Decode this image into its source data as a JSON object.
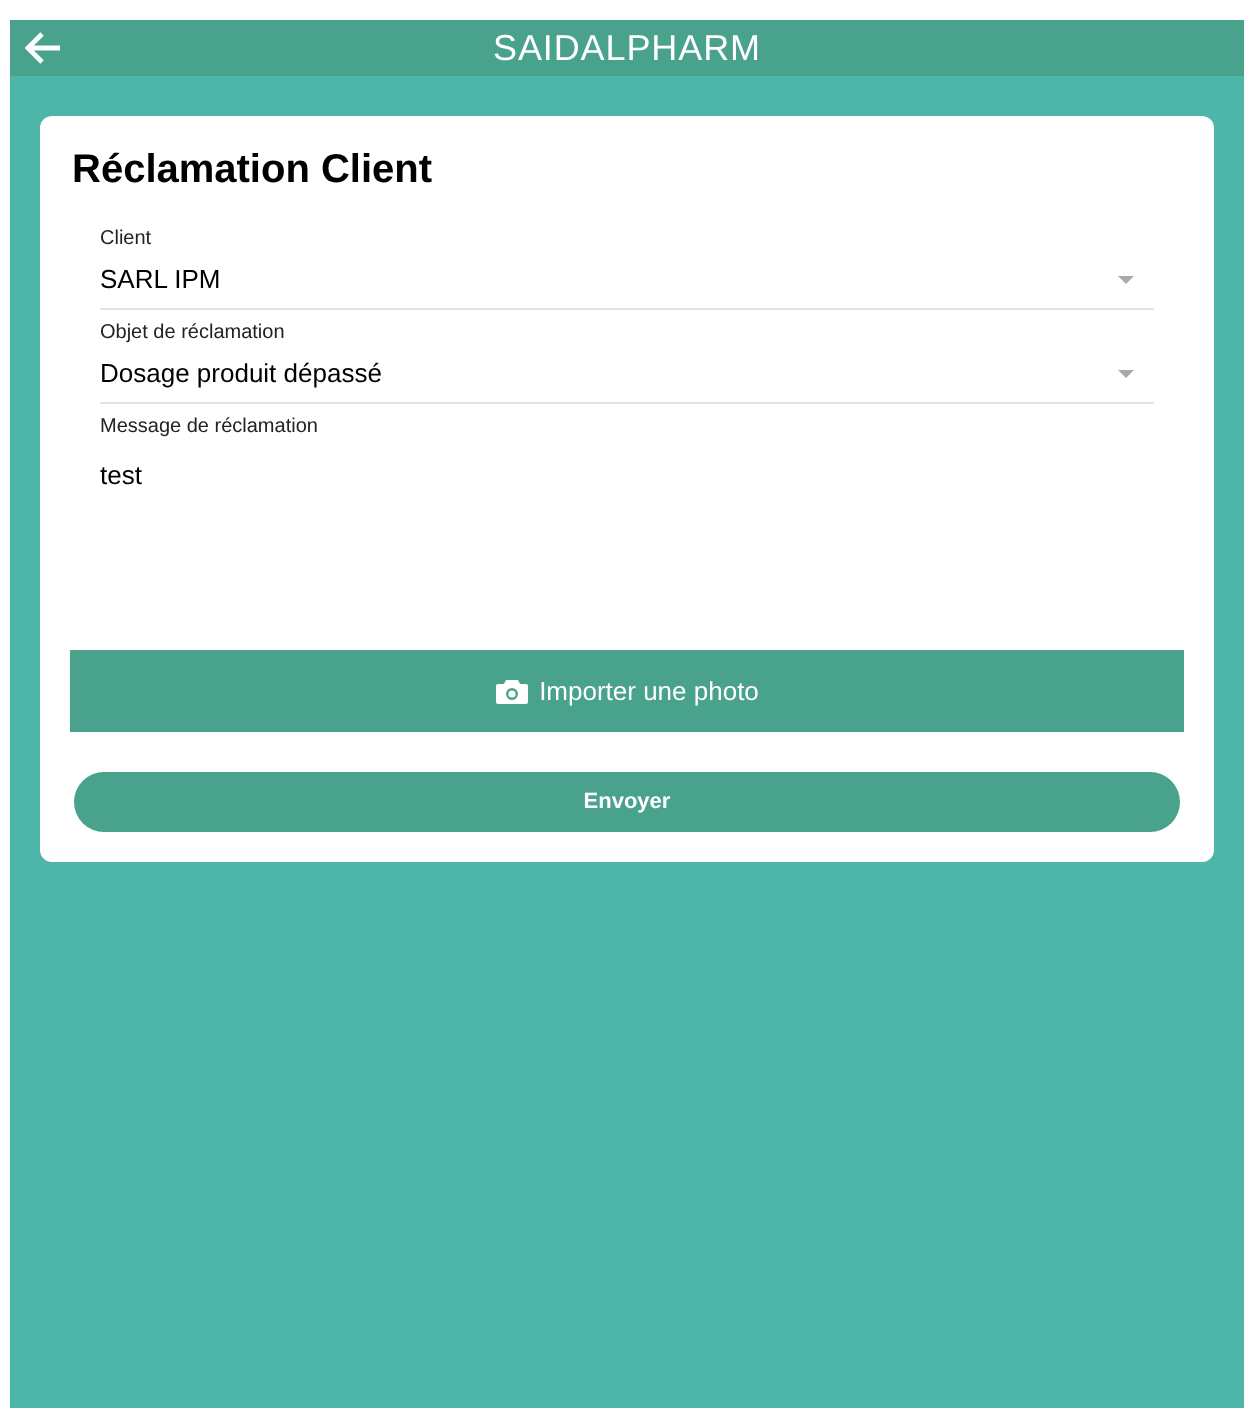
{
  "header": {
    "title": "SAIDALPHARM"
  },
  "form": {
    "title": "Réclamation Client",
    "fields": [
      {
        "kind": "select",
        "label": "Client",
        "value": "SARL IPM"
      },
      {
        "kind": "select",
        "label": "Objet de réclamation",
        "value": "Dosage produit dépassé"
      },
      {
        "kind": "textarea",
        "label": "Message de réclamation",
        "value": "test"
      }
    ],
    "photo_button": "Importer une photo",
    "submit_button": "Envoyer"
  }
}
